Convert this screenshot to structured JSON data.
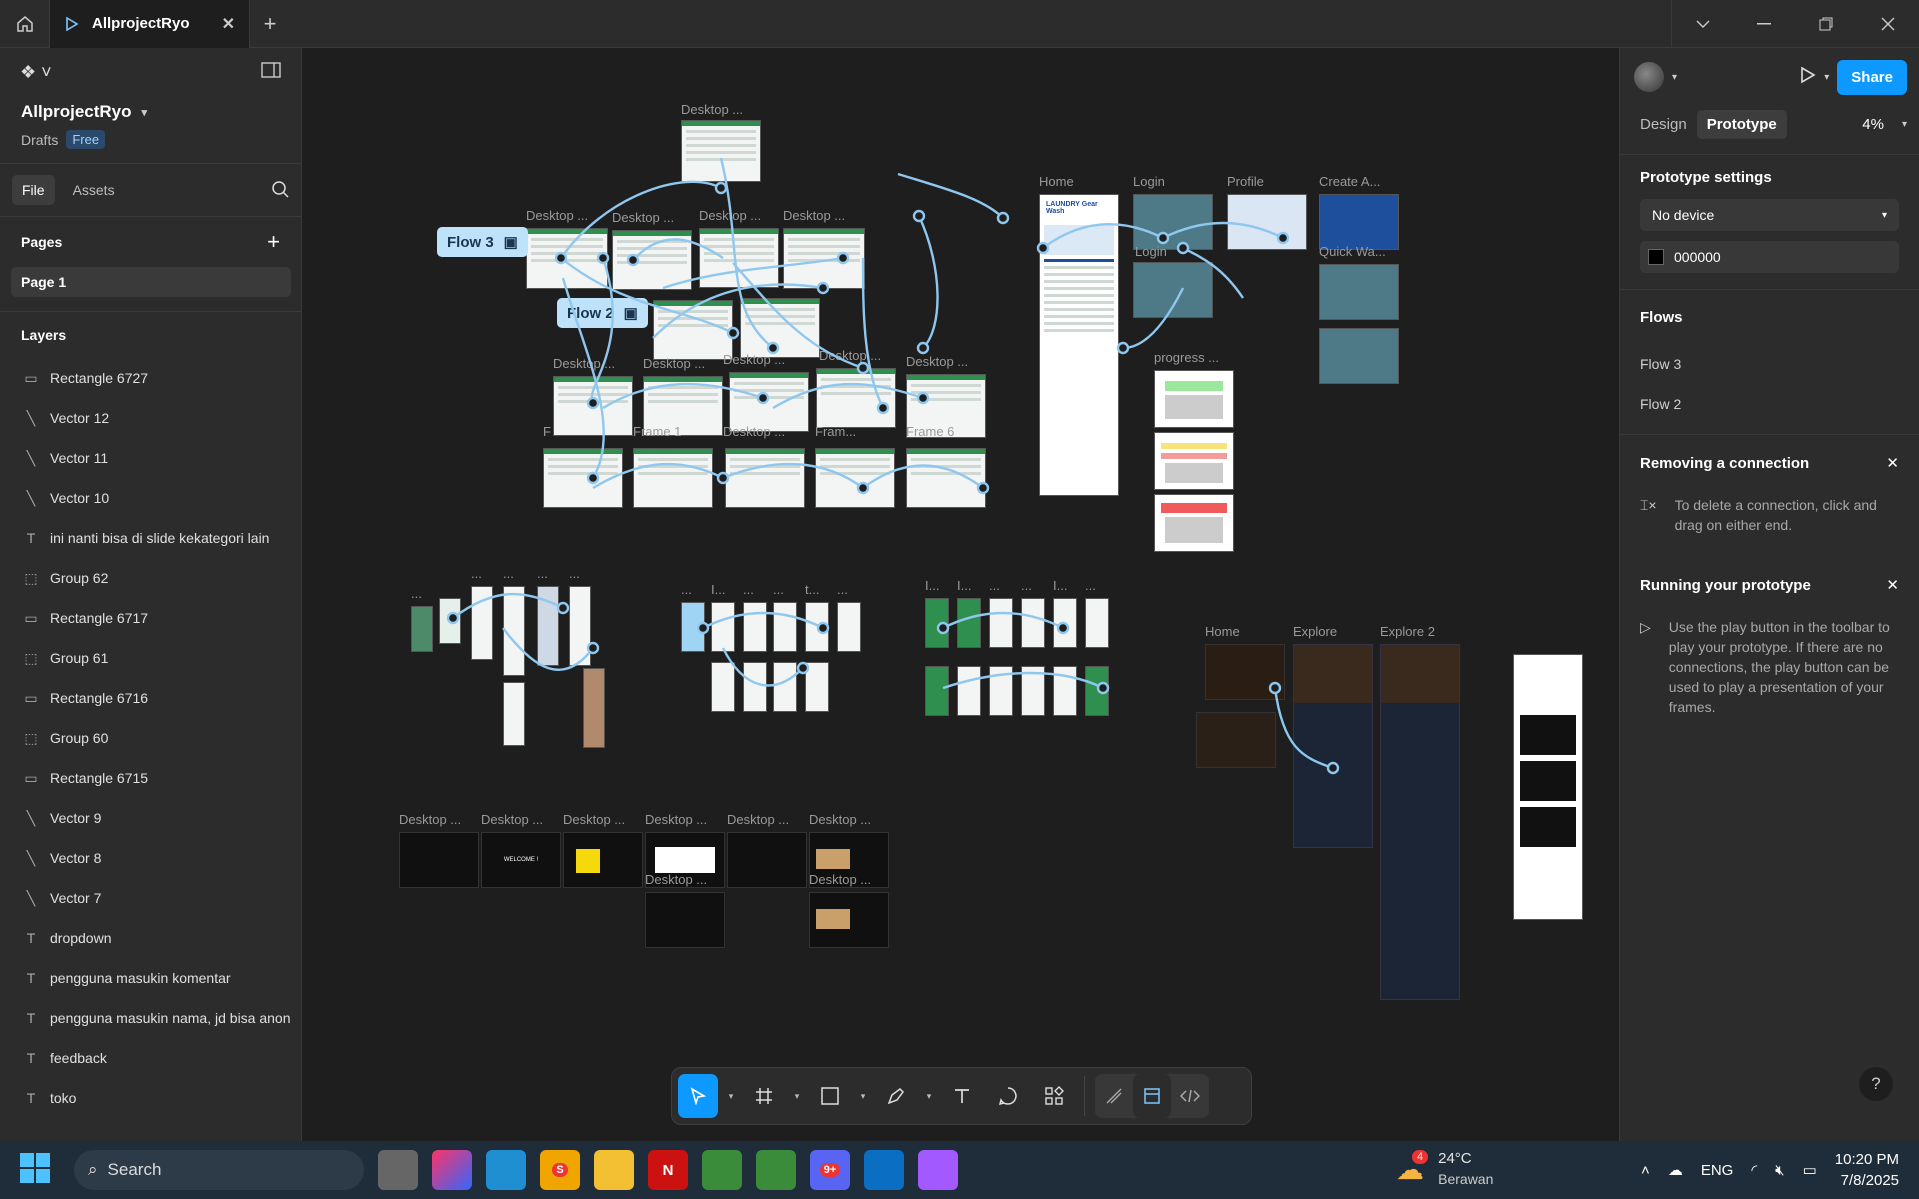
{
  "titlebar": {
    "tab_title": "AllprojectRyo"
  },
  "sidebar": {
    "project_name": "AllprojectRyo",
    "location": "Drafts",
    "plan_badge": "Free",
    "tabs": [
      "File",
      "Assets"
    ],
    "pages_title": "Pages",
    "pages": [
      "Page 1"
    ],
    "layers_title": "Layers",
    "layers": [
      {
        "name": "Rectangle 6727",
        "icon": "rectangle-icon"
      },
      {
        "name": "Vector 12",
        "icon": "vector-icon"
      },
      {
        "name": "Vector 11",
        "icon": "vector-icon"
      },
      {
        "name": "Vector 10",
        "icon": "vector-icon"
      },
      {
        "name": "ini nanti bisa di slide kekategori lain",
        "icon": "text-icon"
      },
      {
        "name": "Group 62",
        "icon": "group-icon"
      },
      {
        "name": "Rectangle 6717",
        "icon": "rectangle-icon"
      },
      {
        "name": "Group 61",
        "icon": "group-icon"
      },
      {
        "name": "Rectangle 6716",
        "icon": "rectangle-icon"
      },
      {
        "name": "Group 60",
        "icon": "group-icon"
      },
      {
        "name": "Rectangle 6715",
        "icon": "rectangle-icon"
      },
      {
        "name": "Vector 9",
        "icon": "vector-icon"
      },
      {
        "name": "Vector 8",
        "icon": "vector-icon"
      },
      {
        "name": "Vector 7",
        "icon": "vector-icon"
      },
      {
        "name": "dropdown",
        "icon": "text-icon"
      },
      {
        "name": "pengguna masukin komentar",
        "icon": "text-icon"
      },
      {
        "name": "pengguna masukin nama, jd bisa anon",
        "icon": "text-icon"
      },
      {
        "name": "feedback",
        "icon": "text-icon"
      },
      {
        "name": "toko",
        "icon": "text-icon"
      }
    ]
  },
  "canvas": {
    "flow_badges": [
      "Flow 3",
      "Flow 2"
    ],
    "labels": {
      "desktop": "Desktop ...",
      "home": "Home",
      "login": "Login",
      "profile": "Profile",
      "create": "Create A...",
      "quick": "Quick Wa...",
      "progress": "progress ...",
      "explore": "Explore",
      "explore2": "Explore 2",
      "frame1": "Frame 1",
      "frame": "Fram...",
      "frame6": "Frame 6",
      "ellipsis": "...",
      "i_ellipsis": "I...",
      "t_ellipsis": "t...",
      "f": "F",
      "login_mid": "Login",
      "laundry_brand": "LAUNDRY Gear Wash",
      "welcome": "WELCOME !"
    }
  },
  "toolbar": {
    "tools": [
      "move-tool",
      "frame-tool",
      "shape-tool",
      "pen-tool",
      "text-tool",
      "comment-tool",
      "actions-tool",
      "draw-mode",
      "design-mode",
      "dev-mode"
    ]
  },
  "right_panel": {
    "share_label": "Share",
    "tabs": [
      "Design",
      "Prototype"
    ],
    "zoom": "4%",
    "settings_title": "Prototype settings",
    "device": "No device",
    "bg_color": "000000",
    "flows_title": "Flows",
    "flows": [
      "Flow 3",
      "Flow 2"
    ],
    "tip1_title": "Removing a connection",
    "tip1_body": "To delete a connection, click and drag on either end.",
    "tip2_title": "Running your prototype",
    "tip2_body": "Use the play button in the toolbar to play your prototype. If there are no connections, the play button can be used to play a presentation of your frames.",
    "help": "?"
  },
  "taskbar": {
    "search_placeholder": "Search",
    "temperature": "24°C",
    "weather": "Berawan",
    "weather_badge": "4",
    "discord_badge": "9+",
    "store_badge": "S",
    "language": "ENG",
    "time": "10:20 PM",
    "date": "7/8/2025"
  },
  "colors": {
    "accent": "#0d99ff",
    "flow_badge": "#bfe2fb",
    "connection": "#8fc7ee"
  }
}
